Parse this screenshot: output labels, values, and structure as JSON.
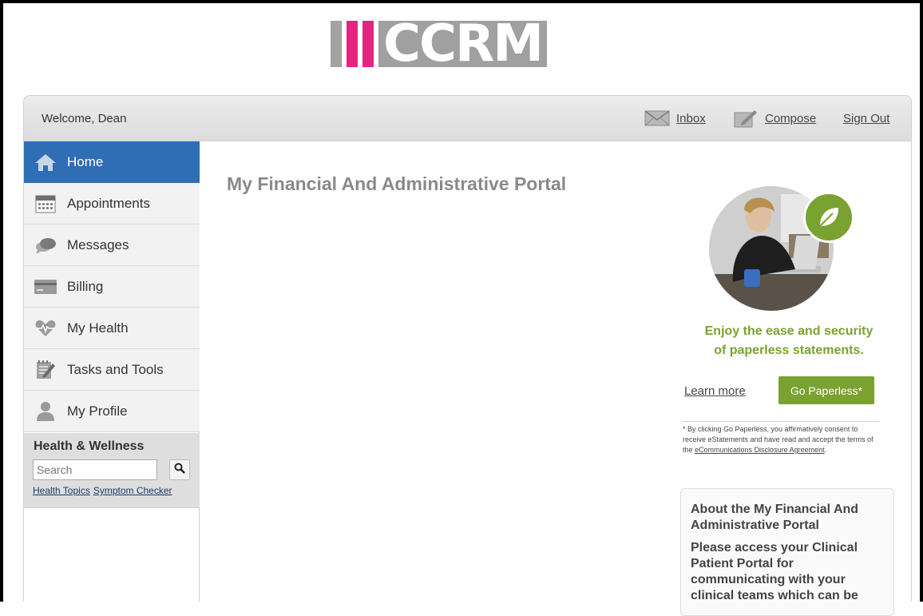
{
  "logo": {
    "text": "CCRM",
    "colors": {
      "gray": "#a3a3a3",
      "pink": "#e2267f"
    }
  },
  "header": {
    "welcome": "Welcome, Dean",
    "inbox": "Inbox",
    "compose": "Compose",
    "sign_out": "Sign Out"
  },
  "sidebar": {
    "items": [
      {
        "label": "Home",
        "icon": "home-icon",
        "active": true
      },
      {
        "label": "Appointments",
        "icon": "calendar-icon"
      },
      {
        "label": "Messages",
        "icon": "chat-bubbles-icon"
      },
      {
        "label": "Billing",
        "icon": "credit-card-icon"
      },
      {
        "label": "My Health",
        "icon": "heart-pulse-icon"
      },
      {
        "label": "Tasks and Tools",
        "icon": "notepad-pencil-icon"
      },
      {
        "label": "My Profile",
        "icon": "person-icon"
      }
    ],
    "health_wellness": {
      "title": "Health & Wellness",
      "search_placeholder": "Search",
      "links": [
        "Health Topics",
        "Symptom Checker"
      ]
    }
  },
  "main": {
    "title": "My Financial And Administrative Portal",
    "promo": {
      "headline_1": "Enjoy the ease and security",
      "headline_2": "of paperless statements.",
      "learn_more": "Learn more",
      "go_paperless": "Go Paperless*",
      "disclaimer_1": "* By clicking Go Paperless, you affirmatively consent to receive eStatements and have read and accept the terms of the",
      "disclaimer_link": "eCommunications Disclosure Agreement",
      "disclaimer_end": "."
    },
    "about": {
      "title": "About the My Financial And Administrative Portal",
      "body": "Please access your Clinical Patient Portal for communicating with your clinical teams which can be"
    }
  },
  "colors": {
    "nav_active": "#2f6db5",
    "green": "#7aa230"
  }
}
